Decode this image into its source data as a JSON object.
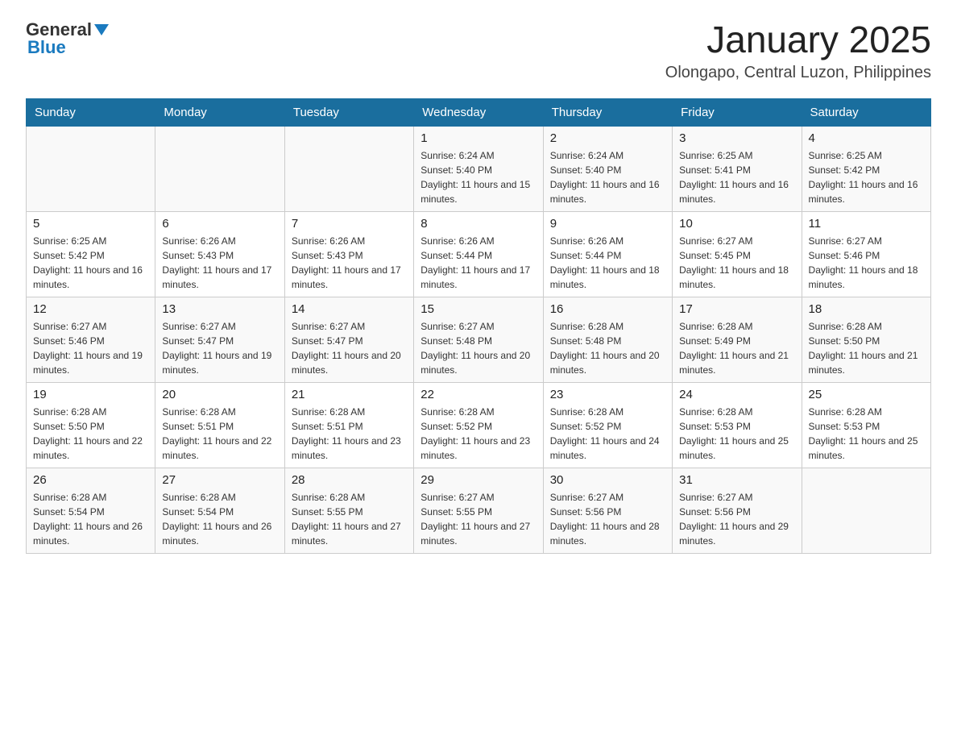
{
  "logo": {
    "general": "General",
    "blue": "Blue"
  },
  "title": "January 2025",
  "location": "Olongapo, Central Luzon, Philippines",
  "headers": [
    "Sunday",
    "Monday",
    "Tuesday",
    "Wednesday",
    "Thursday",
    "Friday",
    "Saturday"
  ],
  "weeks": [
    [
      {
        "day": "",
        "info": ""
      },
      {
        "day": "",
        "info": ""
      },
      {
        "day": "",
        "info": ""
      },
      {
        "day": "1",
        "info": "Sunrise: 6:24 AM\nSunset: 5:40 PM\nDaylight: 11 hours and 15 minutes."
      },
      {
        "day": "2",
        "info": "Sunrise: 6:24 AM\nSunset: 5:40 PM\nDaylight: 11 hours and 16 minutes."
      },
      {
        "day": "3",
        "info": "Sunrise: 6:25 AM\nSunset: 5:41 PM\nDaylight: 11 hours and 16 minutes."
      },
      {
        "day": "4",
        "info": "Sunrise: 6:25 AM\nSunset: 5:42 PM\nDaylight: 11 hours and 16 minutes."
      }
    ],
    [
      {
        "day": "5",
        "info": "Sunrise: 6:25 AM\nSunset: 5:42 PM\nDaylight: 11 hours and 16 minutes."
      },
      {
        "day": "6",
        "info": "Sunrise: 6:26 AM\nSunset: 5:43 PM\nDaylight: 11 hours and 17 minutes."
      },
      {
        "day": "7",
        "info": "Sunrise: 6:26 AM\nSunset: 5:43 PM\nDaylight: 11 hours and 17 minutes."
      },
      {
        "day": "8",
        "info": "Sunrise: 6:26 AM\nSunset: 5:44 PM\nDaylight: 11 hours and 17 minutes."
      },
      {
        "day": "9",
        "info": "Sunrise: 6:26 AM\nSunset: 5:44 PM\nDaylight: 11 hours and 18 minutes."
      },
      {
        "day": "10",
        "info": "Sunrise: 6:27 AM\nSunset: 5:45 PM\nDaylight: 11 hours and 18 minutes."
      },
      {
        "day": "11",
        "info": "Sunrise: 6:27 AM\nSunset: 5:46 PM\nDaylight: 11 hours and 18 minutes."
      }
    ],
    [
      {
        "day": "12",
        "info": "Sunrise: 6:27 AM\nSunset: 5:46 PM\nDaylight: 11 hours and 19 minutes."
      },
      {
        "day": "13",
        "info": "Sunrise: 6:27 AM\nSunset: 5:47 PM\nDaylight: 11 hours and 19 minutes."
      },
      {
        "day": "14",
        "info": "Sunrise: 6:27 AM\nSunset: 5:47 PM\nDaylight: 11 hours and 20 minutes."
      },
      {
        "day": "15",
        "info": "Sunrise: 6:27 AM\nSunset: 5:48 PM\nDaylight: 11 hours and 20 minutes."
      },
      {
        "day": "16",
        "info": "Sunrise: 6:28 AM\nSunset: 5:48 PM\nDaylight: 11 hours and 20 minutes."
      },
      {
        "day": "17",
        "info": "Sunrise: 6:28 AM\nSunset: 5:49 PM\nDaylight: 11 hours and 21 minutes."
      },
      {
        "day": "18",
        "info": "Sunrise: 6:28 AM\nSunset: 5:50 PM\nDaylight: 11 hours and 21 minutes."
      }
    ],
    [
      {
        "day": "19",
        "info": "Sunrise: 6:28 AM\nSunset: 5:50 PM\nDaylight: 11 hours and 22 minutes."
      },
      {
        "day": "20",
        "info": "Sunrise: 6:28 AM\nSunset: 5:51 PM\nDaylight: 11 hours and 22 minutes."
      },
      {
        "day": "21",
        "info": "Sunrise: 6:28 AM\nSunset: 5:51 PM\nDaylight: 11 hours and 23 minutes."
      },
      {
        "day": "22",
        "info": "Sunrise: 6:28 AM\nSunset: 5:52 PM\nDaylight: 11 hours and 23 minutes."
      },
      {
        "day": "23",
        "info": "Sunrise: 6:28 AM\nSunset: 5:52 PM\nDaylight: 11 hours and 24 minutes."
      },
      {
        "day": "24",
        "info": "Sunrise: 6:28 AM\nSunset: 5:53 PM\nDaylight: 11 hours and 25 minutes."
      },
      {
        "day": "25",
        "info": "Sunrise: 6:28 AM\nSunset: 5:53 PM\nDaylight: 11 hours and 25 minutes."
      }
    ],
    [
      {
        "day": "26",
        "info": "Sunrise: 6:28 AM\nSunset: 5:54 PM\nDaylight: 11 hours and 26 minutes."
      },
      {
        "day": "27",
        "info": "Sunrise: 6:28 AM\nSunset: 5:54 PM\nDaylight: 11 hours and 26 minutes."
      },
      {
        "day": "28",
        "info": "Sunrise: 6:28 AM\nSunset: 5:55 PM\nDaylight: 11 hours and 27 minutes."
      },
      {
        "day": "29",
        "info": "Sunrise: 6:27 AM\nSunset: 5:55 PM\nDaylight: 11 hours and 27 minutes."
      },
      {
        "day": "30",
        "info": "Sunrise: 6:27 AM\nSunset: 5:56 PM\nDaylight: 11 hours and 28 minutes."
      },
      {
        "day": "31",
        "info": "Sunrise: 6:27 AM\nSunset: 5:56 PM\nDaylight: 11 hours and 29 minutes."
      },
      {
        "day": "",
        "info": ""
      }
    ]
  ]
}
